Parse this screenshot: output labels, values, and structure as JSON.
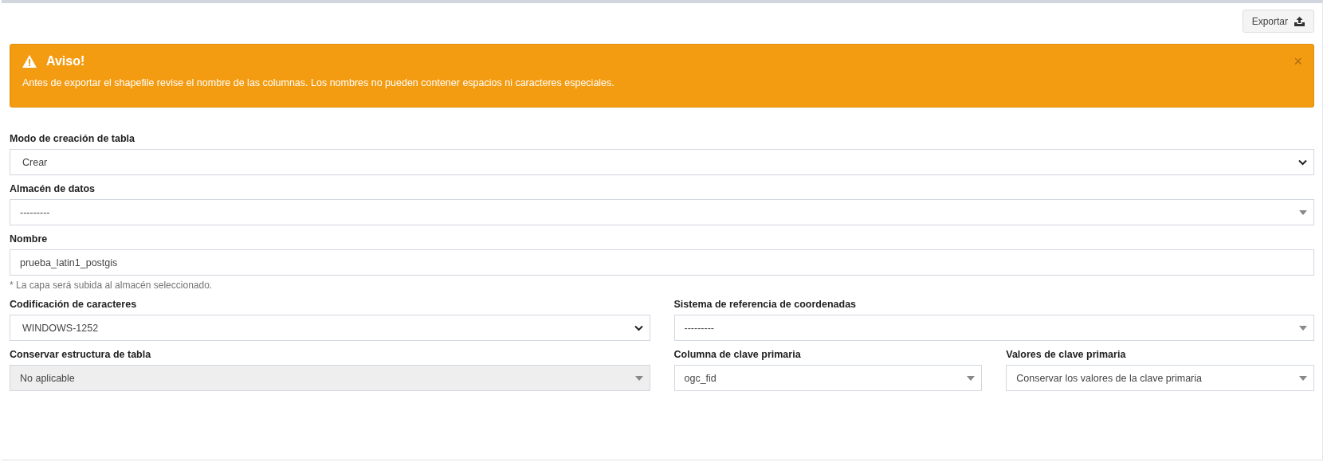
{
  "toolbar": {
    "export_button": "Exportar"
  },
  "alert": {
    "title": "Aviso!",
    "message": "Antes de exportar el shapefile revise el nombre de las columnas. Los nombres no pueden contener espacios ni caracteres especiales.",
    "close": "×"
  },
  "rows": [
    {
      "columns": [
        [
          {
            "label": "Modo de creación de tabla",
            "kind": "native",
            "value": "Crear",
            "disabled": false
          }
        ]
      ]
    },
    {
      "columns": [
        [
          {
            "label": "Almacén de datos",
            "kind": "select2",
            "value": "---------",
            "disabled": false
          }
        ]
      ]
    },
    {
      "columns": [
        [
          {
            "label": "Nombre",
            "kind": "text",
            "value": "prueba_latin1_postgis",
            "disabled": false,
            "help": "* La capa será subida al almacén seleccionado."
          }
        ]
      ]
    },
    {
      "columns": [
        [
          {
            "label": "Codificación de caracteres",
            "kind": "native",
            "value": "WINDOWS-1252",
            "disabled": false
          }
        ],
        [
          {
            "label": "Sistema de referencia de coordenadas",
            "kind": "select2",
            "value": "---------",
            "disabled": false
          }
        ]
      ]
    },
    {
      "columns": [
        [
          {
            "label": "Conservar estructura de tabla",
            "kind": "select2",
            "value": "No aplicable",
            "disabled": true
          }
        ],
        [
          {
            "label": "Columna de clave primaria",
            "kind": "select2",
            "value": "ogc_fid",
            "disabled": false
          },
          {
            "label": "Valores de clave primaria",
            "kind": "select2",
            "value": "Conservar los valores de la clave primaria",
            "disabled": false
          }
        ]
      ]
    }
  ]
}
